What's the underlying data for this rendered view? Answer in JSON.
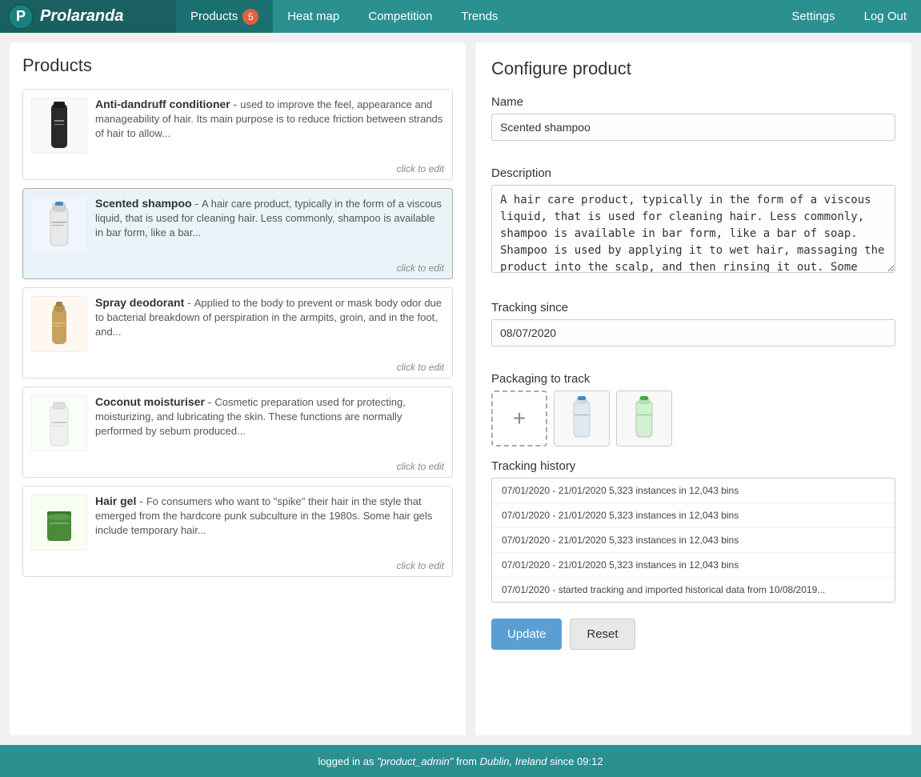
{
  "navbar": {
    "brand": "Prolaranda",
    "items": [
      {
        "label": "Products",
        "badge": "5",
        "active": true
      },
      {
        "label": "Heat map",
        "active": false
      },
      {
        "label": "Competition",
        "active": false
      },
      {
        "label": "Trends",
        "active": false
      }
    ],
    "right_items": [
      {
        "label": "Settings"
      },
      {
        "label": "Log Out"
      }
    ]
  },
  "left_panel": {
    "title": "Products",
    "products": [
      {
        "name": "Anti-dandruff conditioner",
        "desc": "used to improve the feel, appearance and manageability of hair. Its main purpose is to reduce friction between strands of hair to allow...",
        "click_label": "click to edit",
        "selected": false,
        "color": "#333"
      },
      {
        "name": "Scented shampoo",
        "desc": "A hair care product, typically in the form of a viscous liquid, that is used for cleaning hair. Less commonly, shampoo is available in bar form, like a bar...",
        "click_label": "click to edit",
        "selected": true,
        "color": "#333"
      },
      {
        "name": "Spray deodorant",
        "desc": "Applied to the body to prevent or mask body odor due to bacterial breakdown of perspiration in the armpits, groin, and in the foot, and...",
        "click_label": "click to edit",
        "selected": false,
        "color": "#333"
      },
      {
        "name": "Coconut moisturiser",
        "desc": "Cosmetic preparation used for protecting, moisturizing, and lubricating the skin. These functions are normally performed by sebum produced...",
        "click_label": "click to edit",
        "selected": false,
        "color": "#333"
      },
      {
        "name": "Hair gel",
        "desc": "Fo consumers who want to \"spike\" their hair in the style that emerged from the hardcore punk subculture in the 1980s. Some hair gels include temporary hair...",
        "click_label": "click to edit",
        "selected": false,
        "color": "#333"
      }
    ]
  },
  "right_panel": {
    "title": "Configure product",
    "name_label": "Name",
    "name_value": "Scented shampoo",
    "description_label": "Description",
    "description_value": "A hair care product, typically in the form of a viscous liquid, that is used for cleaning hair. Less commonly, shampoo is available in bar form, like a bar of soap. Shampoo is used by applying it to wet hair, massaging the product into the scalp, and then rinsing it out. Some users may follow a shampooing with the use of hair conditioner.",
    "tracking_since_label": "Tracking since",
    "tracking_since_value": "08/07/2020",
    "packaging_label": "Packaging to track",
    "packaging_add_icon": "+",
    "tracking_history_label": "Tracking history",
    "tracking_history": [
      "07/01/2020 - 21/01/2020 5,323 instances in 12,043 bins",
      "07/01/2020 - 21/01/2020 5,323 instances in 12,043 bins",
      "07/01/2020 - 21/01/2020 5,323 instances in 12,043 bins",
      "07/01/2020 - 21/01/2020 5,323 instances in 12,043 bins",
      "07/01/2020 - started tracking and imported historical data from 10/08/2019..."
    ],
    "update_label": "Update",
    "reset_label": "Reset"
  },
  "footer": {
    "text_before": "logged in as ",
    "username": "\"product_admin\"",
    "text_from": " from ",
    "location": "Dublin, Ireland",
    "text_since": " since ",
    "time": "09:12"
  }
}
